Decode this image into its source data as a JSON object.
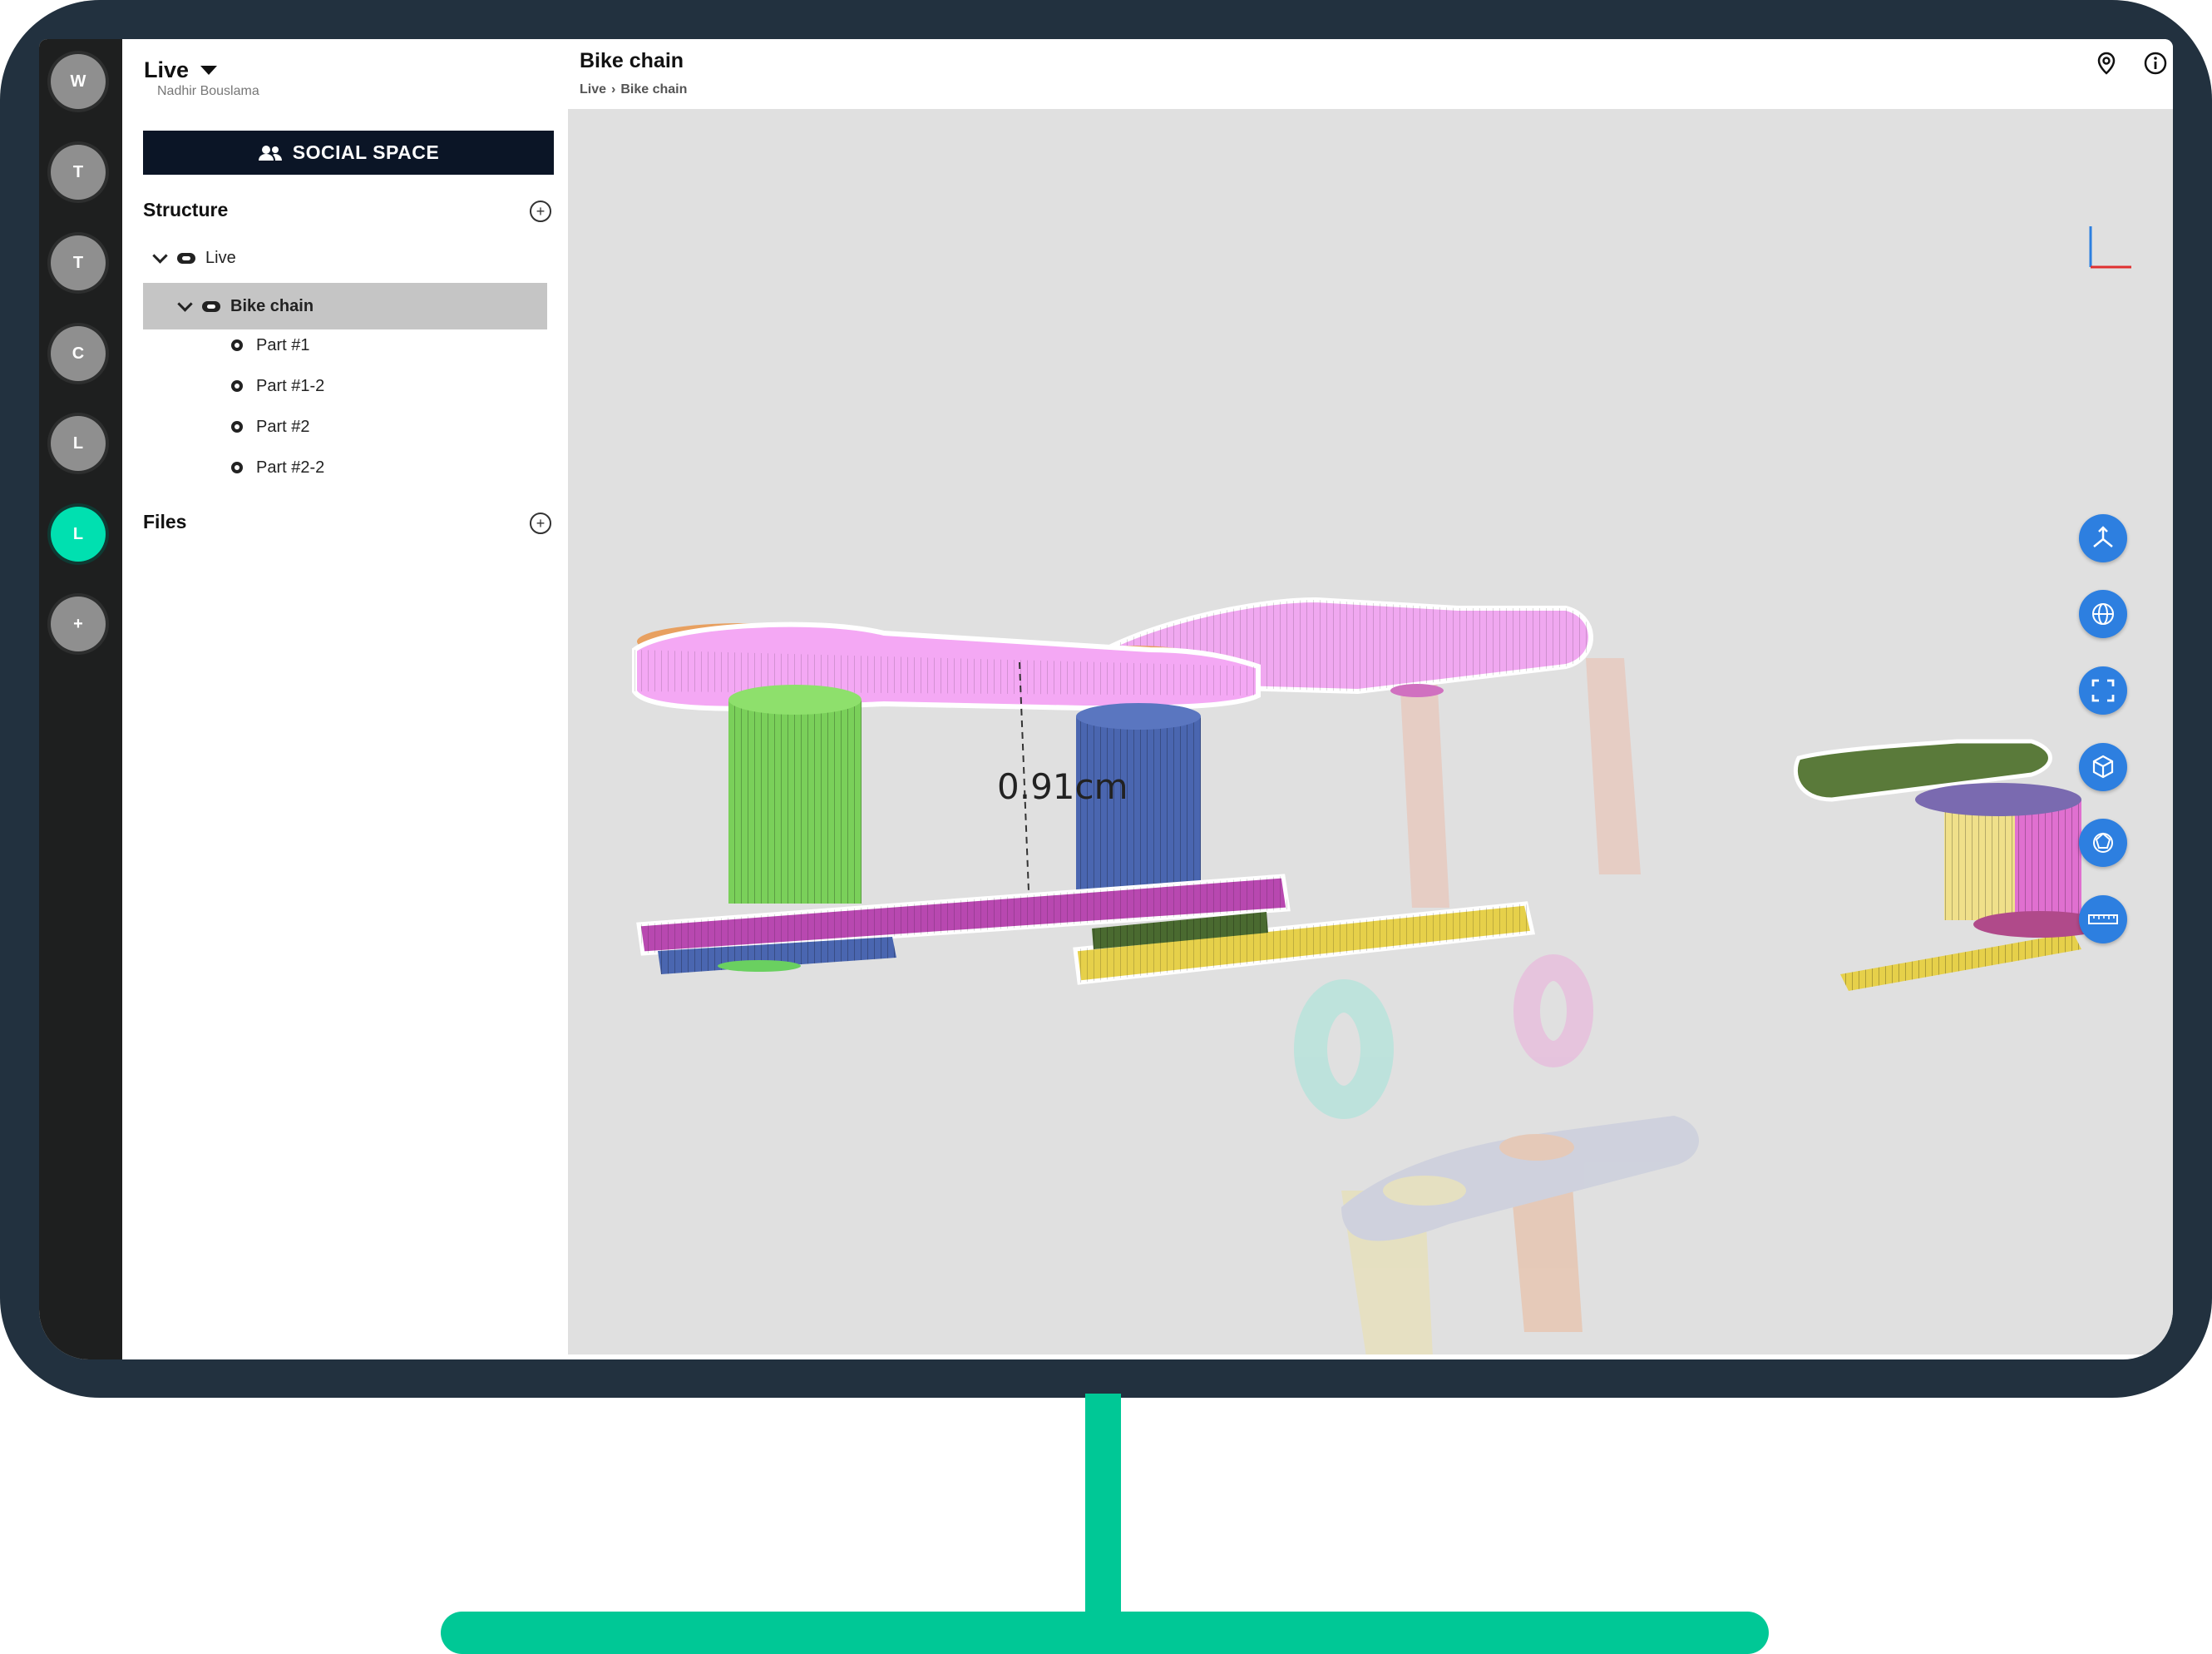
{
  "workspaces": [
    {
      "letter": "W",
      "active": false
    },
    {
      "letter": "T",
      "active": false
    },
    {
      "letter": "T",
      "active": false
    },
    {
      "letter": "C",
      "active": false
    },
    {
      "letter": "L",
      "active": false
    },
    {
      "letter": "L",
      "active": true
    },
    {
      "letter": "+",
      "active": false
    }
  ],
  "panel": {
    "title": "Live",
    "user": "Nadhir Bouslama",
    "social_button": "SOCIAL SPACE",
    "structure_label": "Structure",
    "files_label": "Files",
    "tree": [
      {
        "label": "Live",
        "level": 0,
        "type": "assembly",
        "expanded": true
      },
      {
        "label": "Bike chain",
        "level": 1,
        "type": "assembly",
        "expanded": true,
        "selected": true
      },
      {
        "label": "Part #1",
        "level": 2,
        "type": "part"
      },
      {
        "label": "Part #1-2",
        "level": 2,
        "type": "part"
      },
      {
        "label": "Part #2",
        "level": 2,
        "type": "part"
      },
      {
        "label": "Part #2-2",
        "level": 2,
        "type": "part"
      }
    ]
  },
  "header": {
    "title": "Bike chain",
    "breadcrumb": [
      "Live",
      "›",
      "Bike chain"
    ]
  },
  "viewport": {
    "measurement": "0.91cm",
    "tools": [
      "axes-tool-icon",
      "globe-tool-icon",
      "fit-view-icon",
      "cube-view-icon",
      "explode-icon",
      "ruler-icon"
    ]
  },
  "colors": {
    "accent": "#00c896",
    "active_workspace": "#00e0b0",
    "tool_button": "#2d7fe0",
    "frame": "#22313f"
  }
}
